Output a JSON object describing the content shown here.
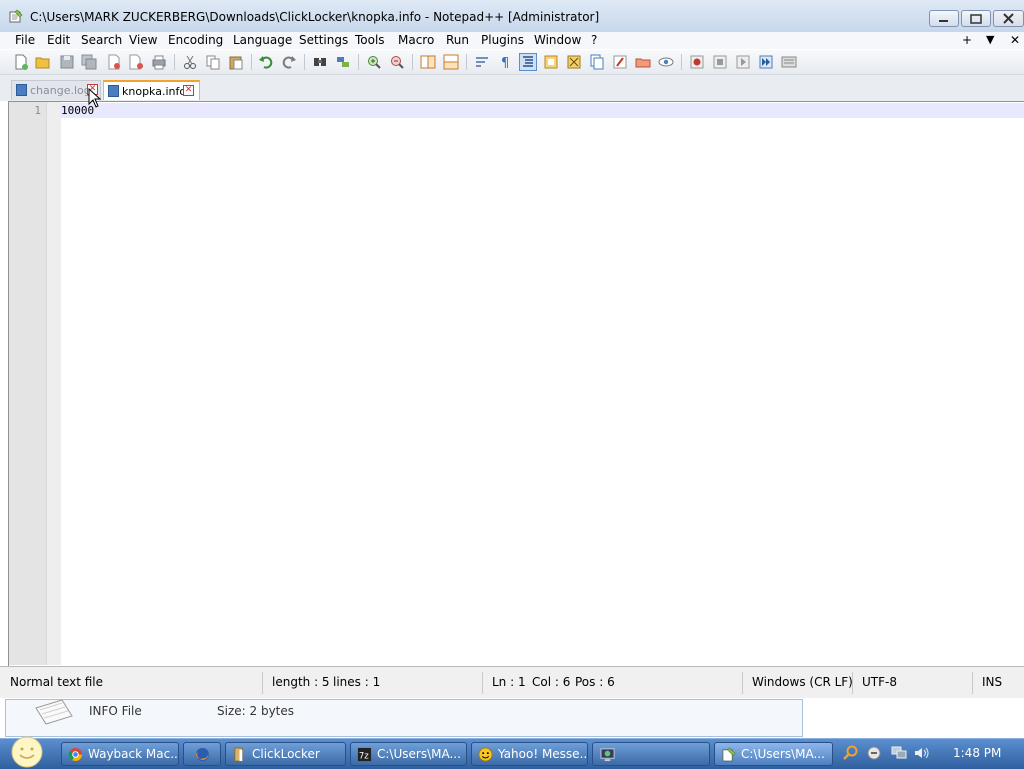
{
  "window": {
    "title": "C:\\Users\\MARK ZUCKERBERG\\Downloads\\ClickLocker\\knopka.info - Notepad++ [Administrator]"
  },
  "menu": {
    "items": [
      "File",
      "Edit",
      "Search",
      "View",
      "Encoding",
      "Language",
      "Settings",
      "Tools",
      "Macro",
      "Run",
      "Plugins",
      "Window",
      "?"
    ],
    "right": {
      "plus": "+",
      "down": "▼",
      "close": "✕"
    }
  },
  "tabs": [
    {
      "label": "change.log",
      "active": false
    },
    {
      "label": "knopka.info",
      "active": true
    }
  ],
  "editor": {
    "lines": [
      {
        "number": "1",
        "text": "10000"
      }
    ],
    "current_line_color": "#e8e8ff"
  },
  "status": {
    "file_type": "Normal text file",
    "length": "length : 5",
    "lines": "lines : 1",
    "ln": "Ln : 1",
    "col": "Col : 6",
    "pos": "Pos : 6",
    "eol": "Windows (CR LF)",
    "encoding": "UTF-8",
    "mode": "INS"
  },
  "explorer_details": {
    "type": "INFO File",
    "size_label": "Size:",
    "size_value": "2 bytes"
  },
  "taskbar": {
    "items": [
      {
        "label": "Wayback Mac...",
        "icon": "chrome-icon"
      },
      {
        "label": "",
        "icon": "firefox-icon"
      },
      {
        "label": "ClickLocker",
        "icon": "folder-icon"
      },
      {
        "label": "C:\\Users\\MA...",
        "icon": "7zip-icon"
      },
      {
        "label": "Yahoo! Messe...",
        "icon": "yahoo-messenger-icon"
      },
      {
        "label": "",
        "icon": "program-icon"
      },
      {
        "label": "C:\\Users\\MA...",
        "icon": "notepad-plus-plus-icon"
      }
    ],
    "clock": "1:48 PM"
  },
  "colors": {
    "tab_active_accent": "#f2a32b",
    "close_x": "#c23a3a",
    "taskbar": "#3b6aa6"
  }
}
